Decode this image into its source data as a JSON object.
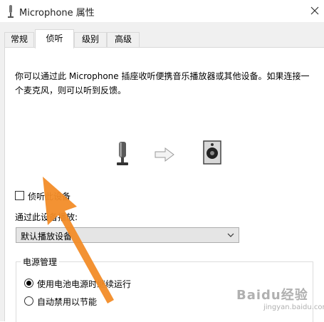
{
  "window": {
    "title": "Microphone 属性",
    "close_icon": "close-icon"
  },
  "tabs": [
    {
      "label": "常规",
      "active": false
    },
    {
      "label": "侦听",
      "active": true
    },
    {
      "label": "级别",
      "active": false
    },
    {
      "label": "高级",
      "active": false
    }
  ],
  "listen": {
    "description": "你可以通过此 Microphone 插座收听便携音乐播放器或其他设备。如果连接一个麦克风，则可以听到反馈。",
    "flow_icons": [
      "microphone-icon",
      "arrow-right-icon",
      "speaker-icon"
    ],
    "listen_checkbox_label": "侦听此设备",
    "listen_checked": false,
    "playback_label": "通过此设备播放:",
    "playback_selected": "默认播放设备"
  },
  "power": {
    "group_title": "电源管理",
    "options": [
      {
        "label": "使用电池电源时继续运行",
        "checked": true
      },
      {
        "label": "自动禁用以节能",
        "checked": false
      }
    ]
  },
  "overlay": {
    "annotation": "orange-arrow-annotation",
    "accent_color": "#f28c28"
  },
  "watermark": {
    "main": "Baidu经验",
    "sub": "jingyan.baidu.com"
  }
}
